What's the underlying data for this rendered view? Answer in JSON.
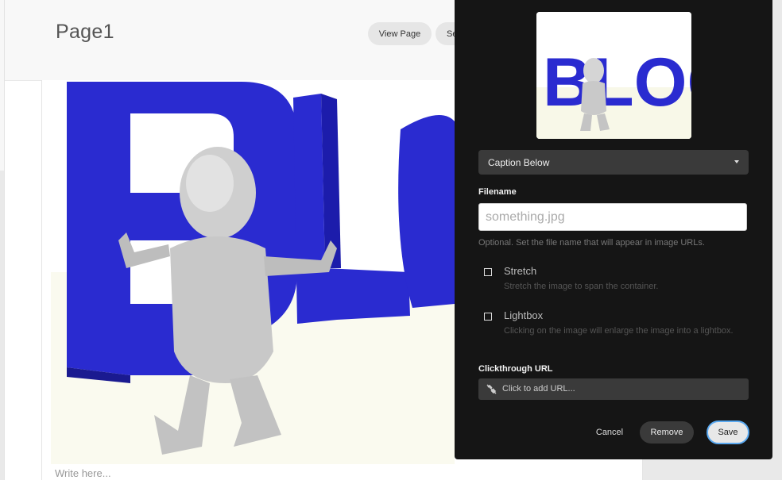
{
  "header": {
    "title": "Page1",
    "view_page_label": "View Page",
    "second_button_label": "Se"
  },
  "editor": {
    "placeholder_text": "Write here..."
  },
  "image_panel": {
    "thumbnail_text": "BLOG",
    "caption_select": {
      "selected": "Caption Below"
    },
    "filename": {
      "label": "Filename",
      "placeholder": "something.jpg",
      "help": "Optional. Set the file name that will appear in image URLs."
    },
    "stretch": {
      "label": "Stretch",
      "description": "Stretch the image to span the container.",
      "checked": false
    },
    "lightbox": {
      "label": "Lightbox",
      "description": "Clicking on the image will enlarge the image into a lightbox.",
      "checked": false
    },
    "clickthrough": {
      "label": "Clickthrough URL",
      "placeholder": "Click to add URL..."
    },
    "buttons": {
      "cancel": "Cancel",
      "remove": "Remove",
      "save": "Save"
    }
  },
  "colors": {
    "panel_bg": "#151515",
    "letter_blue": "#2c2dcc",
    "save_outline": "#5aa9f0"
  }
}
